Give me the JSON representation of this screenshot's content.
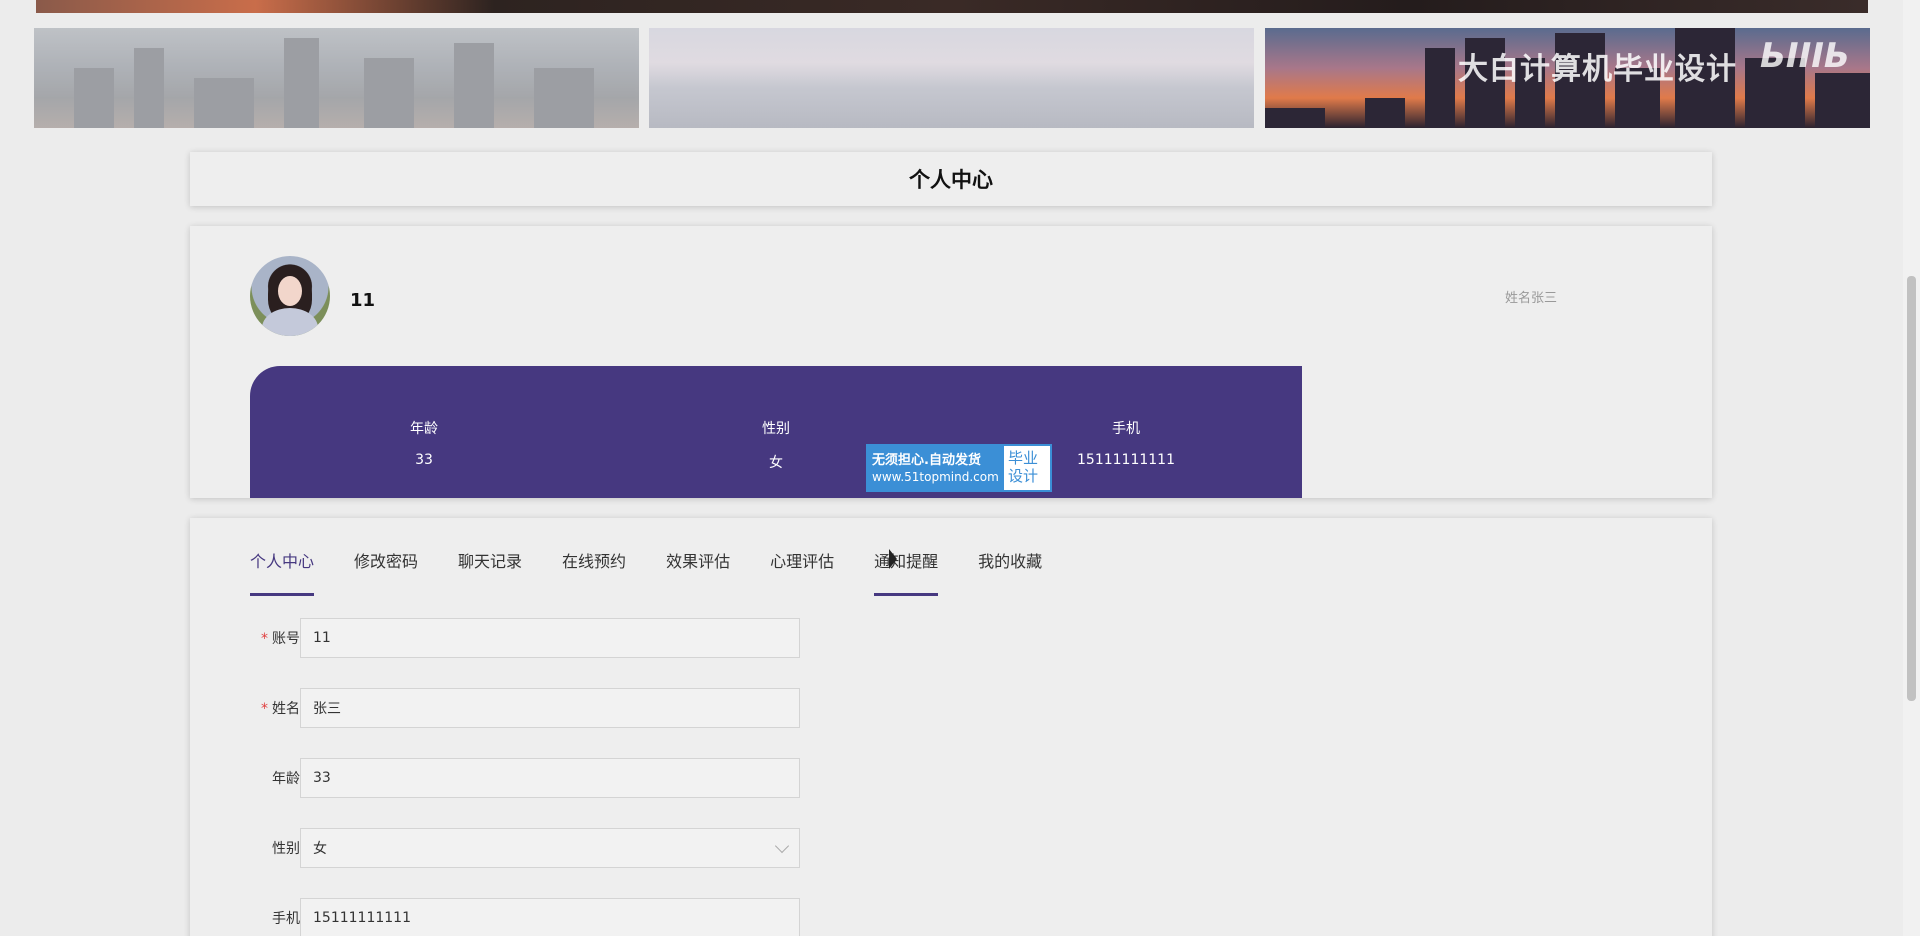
{
  "watermark": {
    "text": "大白计算机毕业设计",
    "logo": "bilibili"
  },
  "page_title": "个人中心",
  "profile": {
    "username": "11",
    "name_hint": "姓名张三",
    "stats": [
      {
        "label": "年龄",
        "value": "33"
      },
      {
        "label": "性别",
        "value": "女"
      },
      {
        "label": "手机",
        "value": "15111111111"
      }
    ]
  },
  "promo": {
    "line1": "无须担心.自动发货",
    "line2": "www.51topmind.com",
    "right": "毕业设计"
  },
  "tabs": [
    {
      "label": "个人中心",
      "active": true
    },
    {
      "label": "修改密码",
      "active": false
    },
    {
      "label": "聊天记录",
      "active": false
    },
    {
      "label": "在线预约",
      "active": false
    },
    {
      "label": "效果评估",
      "active": false
    },
    {
      "label": "心理评估",
      "active": false
    },
    {
      "label": "通知提醒",
      "active": false,
      "hover": true
    },
    {
      "label": "我的收藏",
      "active": false
    }
  ],
  "form": {
    "account": {
      "label": "账号",
      "required": true,
      "value": "11"
    },
    "name": {
      "label": "姓名",
      "required": true,
      "value": "张三"
    },
    "age": {
      "label": "年龄",
      "required": false,
      "value": "33"
    },
    "gender": {
      "label": "性别",
      "required": false,
      "value": "女"
    },
    "phone": {
      "label": "手机",
      "required": false,
      "value": "15111111111"
    }
  },
  "colors": {
    "accent": "#463880",
    "required": "#e04040"
  }
}
